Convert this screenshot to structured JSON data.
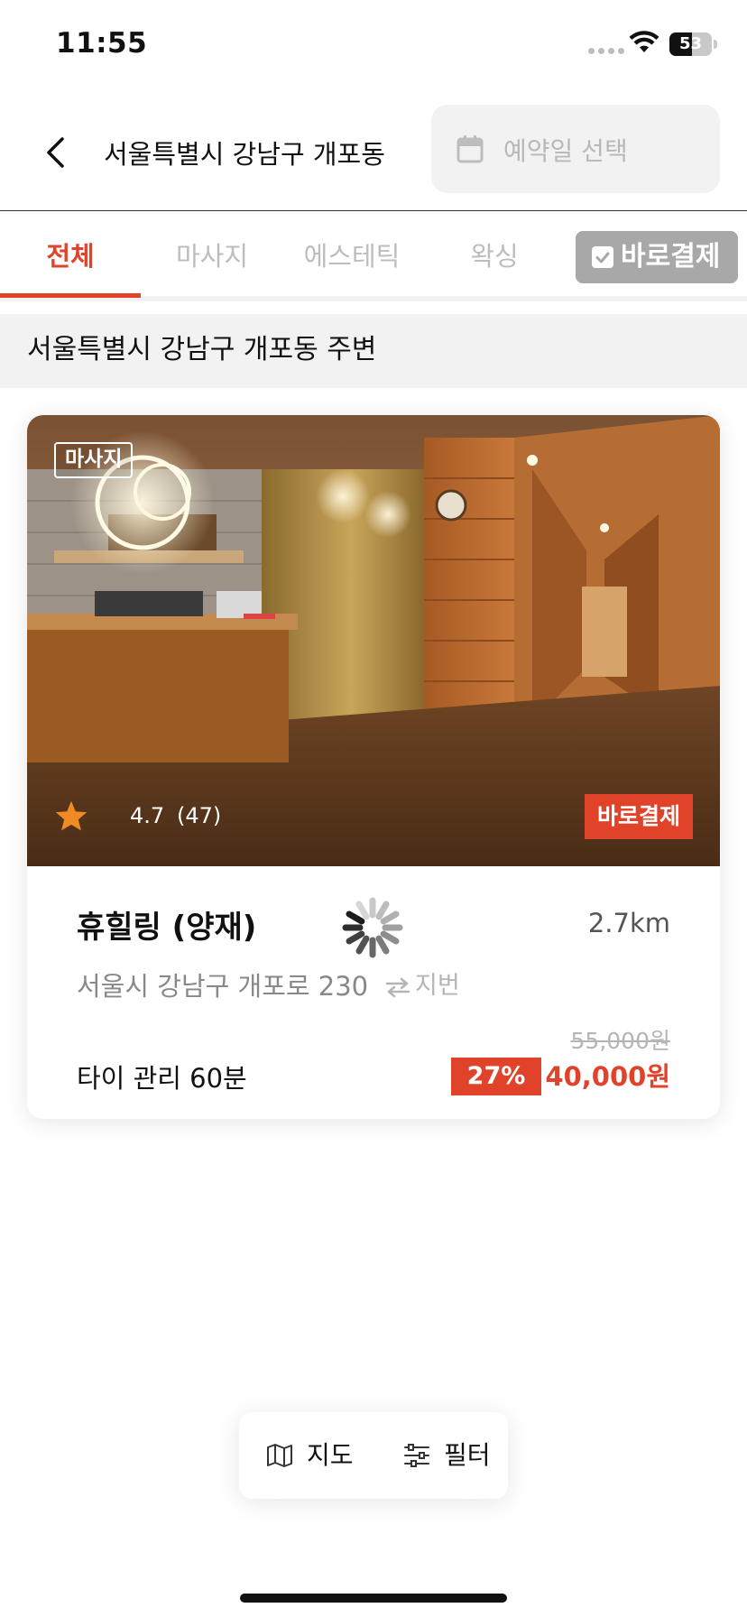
{
  "status_bar": {
    "time": "11:55",
    "battery_level": "53",
    "battery_fraction": 0.53
  },
  "header": {
    "title": "서울특별시 강남구 개포동",
    "date_placeholder": "예약일 선택"
  },
  "tabs": [
    {
      "label": "전체",
      "active": true
    },
    {
      "label": "마사지",
      "active": false
    },
    {
      "label": "에스테틱",
      "active": false
    },
    {
      "label": "왁싱",
      "active": false
    }
  ],
  "instant_pay_toggle": {
    "label": "바로결제",
    "checked": true
  },
  "section": {
    "title": "서울특별시 강남구 개포동 주변"
  },
  "shop": {
    "category": "마사지",
    "rating": "4.7",
    "review_count": "(47)",
    "instant_pay_badge": "바로결제",
    "name": "휴힐링 (양재)",
    "distance": "2.7km",
    "address": "서울시 강남구 개포로 230",
    "address_toggle": "지번",
    "service": "타이 관리 60분",
    "original_price": "55,000원",
    "discount": "27%",
    "sale_price": "40,000원"
  },
  "bottom_bar": {
    "map_label": "지도",
    "filter_label": "필터"
  },
  "colors": {
    "accent": "#e0432a",
    "inactive_tab": "#bdbdbd",
    "section_bg": "#f2f2f2",
    "star": "#f08a24"
  },
  "icons": [
    "back-arrow-icon",
    "calendar-icon",
    "checkbox-icon",
    "star-icon",
    "loading-spinner-icon",
    "swap-icon",
    "map-icon",
    "filter-icon",
    "wifi-icon",
    "battery-icon"
  ]
}
